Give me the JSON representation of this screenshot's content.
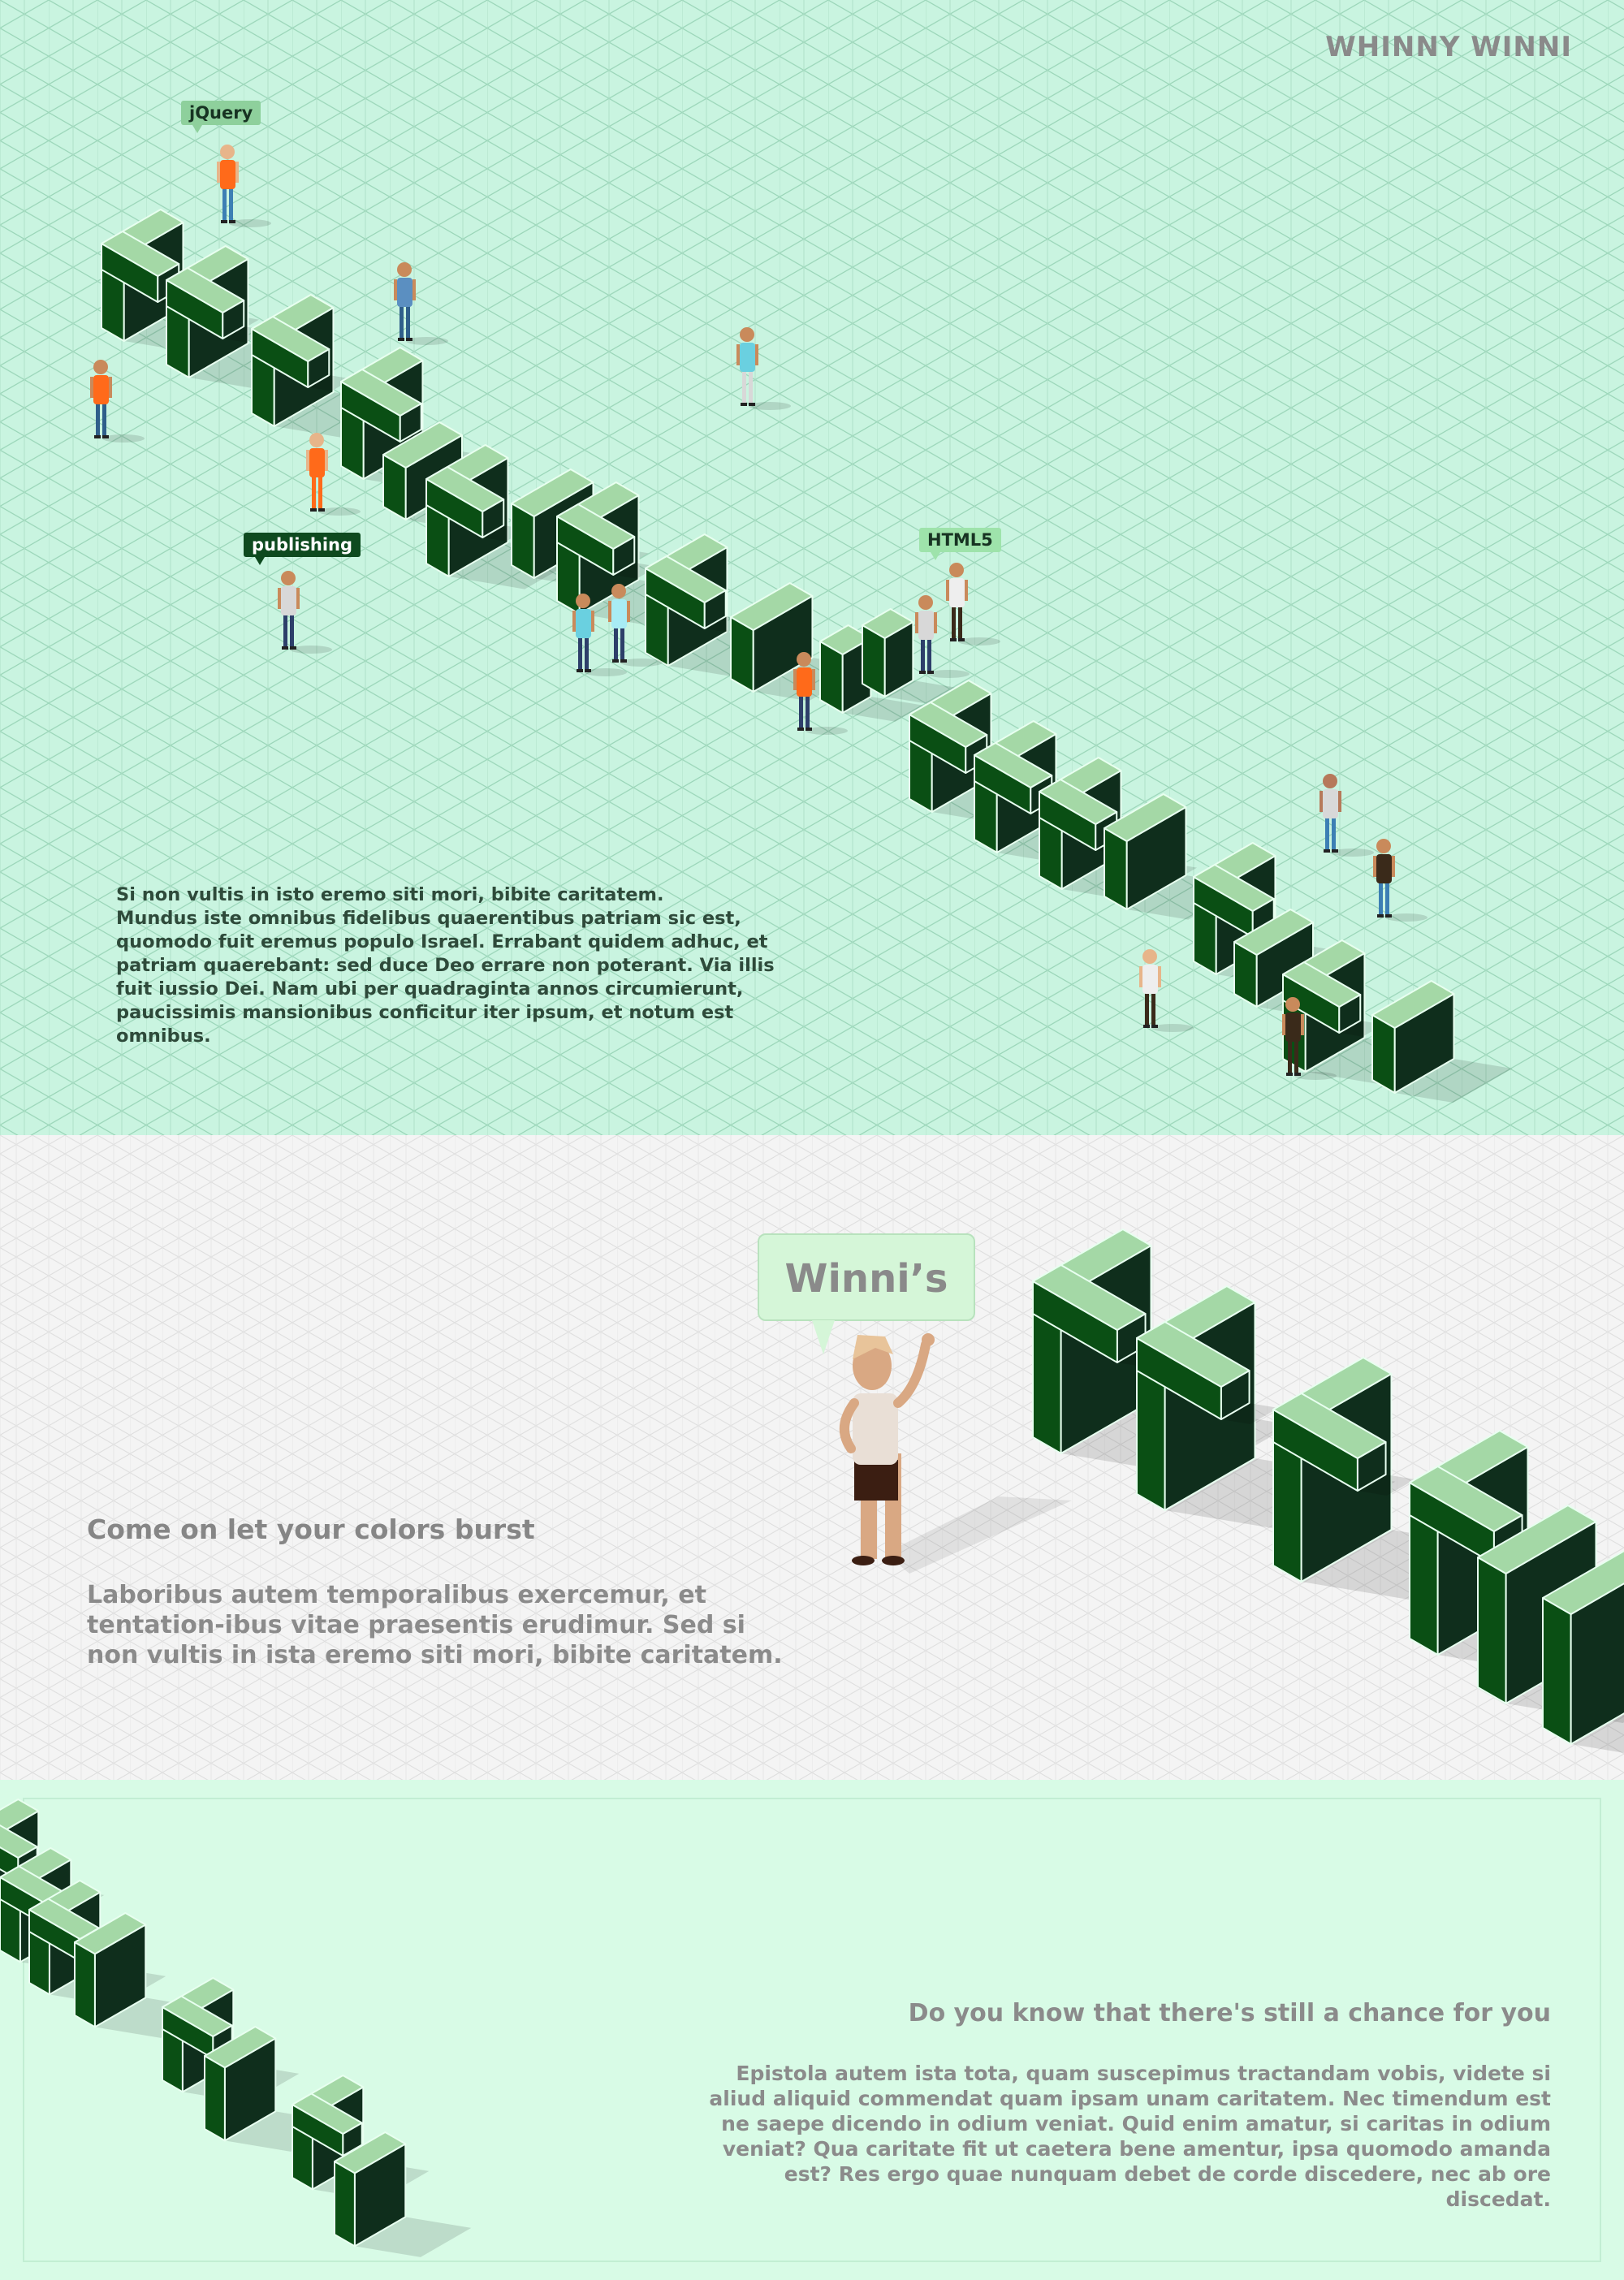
{
  "brand": "WHINNY WINNI",
  "hero": {
    "intro_line1": "Si non vultis in isto eremo siti mori, bibite caritatem.",
    "intro_line2": "Mundus iste omnibus fidelibus quaerentibus patriam sic est, quomodo fuit eremus populo Israel. Errabant quidem adhuc, et patriam quaerebant: sed duce Deo errare non poterant. Via illis fuit iussio Dei. Nam ubi per quadraginta annos circumierunt, paucissimis mansionibus conficitur iter ipsum, et notum est omnibus.",
    "tags": {
      "jquery": "jQuery",
      "publishing": "publishing",
      "html5": "HTML5"
    }
  },
  "feature": {
    "bubble": "Winni’s",
    "heading": "Come on let your colors burst",
    "text": "Laboribus autem temporalibus exercemur, et tentation-ibus vitae praesentis erudimur. Sed si non vultis in ista eremo siti mori, bibite caritatem."
  },
  "closing": {
    "heading": "Do you know that there's still a chance for you",
    "text": "Epistola autem ista tota, quam suscepimus tractandam vobis, videte si aliud aliquid commendat quam ipsam unam caritatem. Nec timendum est ne saepe dicendo in odium veniat. Quid enim amatur, si caritas in odium veniat? Qua caritate fit ut caetera bene amentur, ipsa quomodo amanda est? Res ergo quae nunquam debet de corde discedere, nec ab ore discedat."
  },
  "colors": {
    "hero_bg": "#c9f4e0",
    "block_top": "#a4d8a6",
    "block_left": "#0a4f14",
    "block_right": "#0f2e1c"
  }
}
